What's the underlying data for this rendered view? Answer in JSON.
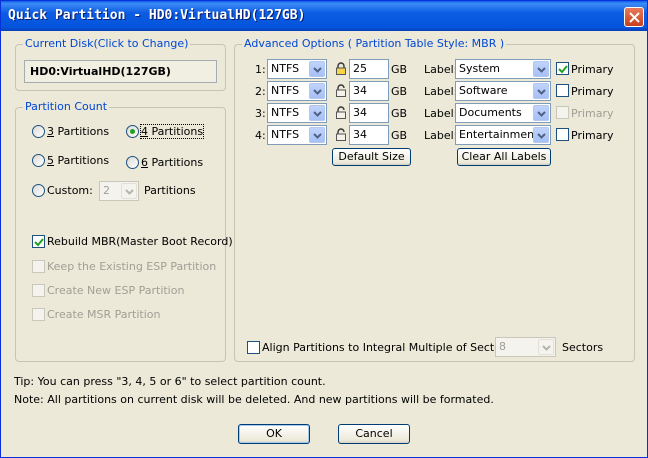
{
  "window": {
    "title": "Quick Partition - HD0:VirtualHD(127GB)"
  },
  "current_disk": {
    "legend": "Current Disk(Click to Change)",
    "value": "HD0:VirtualHD(127GB)"
  },
  "partition_count": {
    "legend": "Partition Count",
    "options": [
      {
        "key": "3",
        "rest": " Partitions",
        "selected": false
      },
      {
        "key": "4",
        "rest": " Partitions",
        "selected": true
      },
      {
        "key": "5",
        "rest": " Partitions",
        "selected": false
      },
      {
        "key": "6",
        "rest": " Partitions",
        "selected": false
      }
    ],
    "custom_label": "Custom:",
    "custom_value": "2",
    "custom_suffix": "Partitions",
    "checkboxes": [
      {
        "label": "Rebuild MBR(Master Boot Record)",
        "checked": true,
        "enabled": true
      },
      {
        "label": "Keep the Existing ESP Partition",
        "checked": false,
        "enabled": false
      },
      {
        "label": "Create New ESP Partition",
        "checked": false,
        "enabled": false
      },
      {
        "label": "Create MSR Partition",
        "checked": false,
        "enabled": false
      }
    ]
  },
  "advanced": {
    "legend": "Advanced Options ( Partition Table Style: MBR )",
    "size_unit": "GB",
    "label_caption": "Label:",
    "primary_caption": "Primary",
    "rows": [
      {
        "index": "1:",
        "fs": "NTFS",
        "locked": true,
        "size": "25",
        "label": "System",
        "primary_checked": true,
        "primary_enabled": true
      },
      {
        "index": "2:",
        "fs": "NTFS",
        "locked": false,
        "size": "34",
        "label": "Software",
        "primary_checked": false,
        "primary_enabled": true
      },
      {
        "index": "3:",
        "fs": "NTFS",
        "locked": false,
        "size": "34",
        "label": "Documents",
        "primary_checked": false,
        "primary_enabled": false
      },
      {
        "index": "4:",
        "fs": "NTFS",
        "locked": false,
        "size": "34",
        "label": "Entertainment",
        "primary_checked": false,
        "primary_enabled": true
      }
    ],
    "default_size_button": "Default Size",
    "clear_labels_button": "Clear All Labels",
    "align_label": "Align Partitions to Integral Multiple of Sectors:",
    "align_value": "8",
    "align_suffix": "Sectors"
  },
  "tips": {
    "tip": "Tip:  You can press \"3, 4, 5 or 6\" to select partition count.",
    "note": "Note: All partitions on current disk will be deleted. And new partitions will be formated."
  },
  "buttons": {
    "ok": "OK",
    "cancel": "Cancel"
  },
  "icons": {
    "close": "close-icon",
    "combo_arrow": "chevron-down-icon",
    "lock_closed": "lock-icon",
    "lock_open": "unlock-icon",
    "check": "checkmark-icon"
  }
}
